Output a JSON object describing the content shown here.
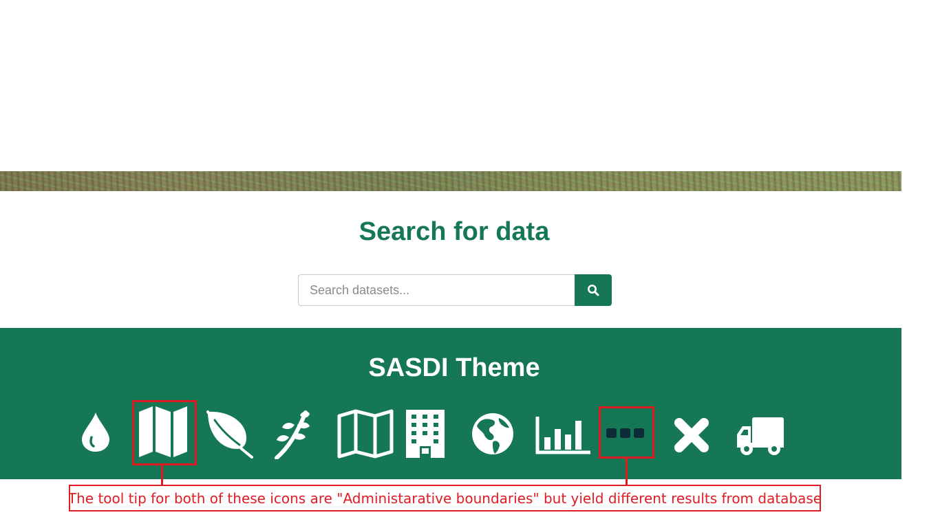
{
  "search": {
    "title": "Search for data",
    "placeholder": "Search datasets...",
    "button_icon": "search-icon"
  },
  "theme": {
    "title": "SASDI Theme",
    "icons": [
      "water-drop-icon",
      "folded-map-solid-icon",
      "leaf-icon",
      "seedling-icon",
      "folded-map-outline-icon",
      "building-icon",
      "globe-americas-icon",
      "bar-chart-icon",
      "ellipsis-icon",
      "cross-icon",
      "truck-icon"
    ]
  },
  "annotation": {
    "text": "The tool tip for both of these icons are \"Administarative boundaries\" but yield different results from database"
  },
  "colors": {
    "brand_green": "#167755",
    "annotation_red": "#e11b24",
    "ellipsis_dots": "#0c2c3a"
  }
}
